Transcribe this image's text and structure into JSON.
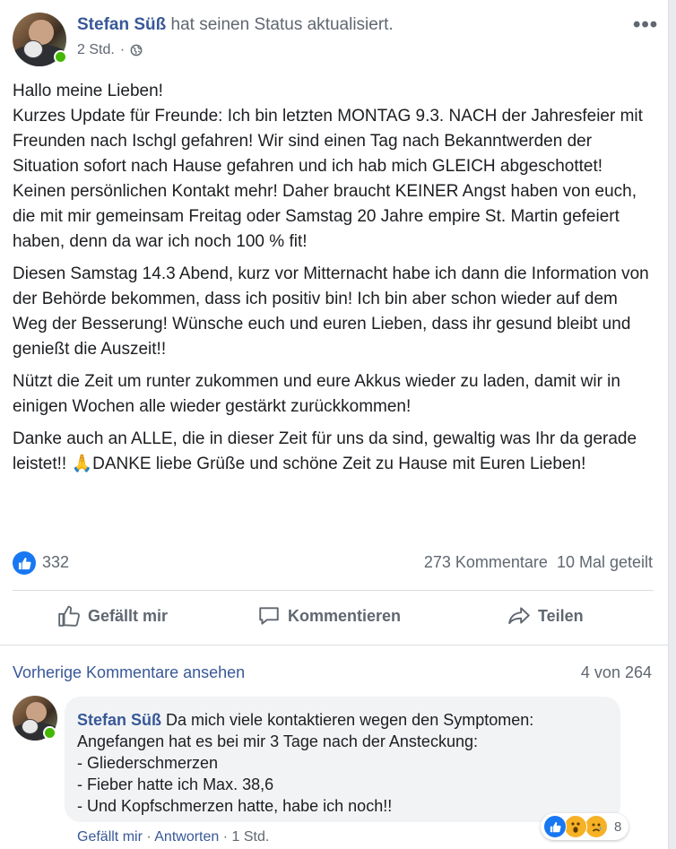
{
  "post": {
    "author": "Stefan Süß",
    "header_suffix": "hat seinen Status aktualisiert.",
    "time": "2 Std.",
    "more_label": "•••",
    "paragraphs": [
      "Hallo meine Lieben!\nKurzes Update für Freunde: Ich bin letzten MONTAG 9.3. NACH der Jahresfeier mit Freunden nach Ischgl gefahren! Wir sind einen Tag nach Bekanntwerden der Situation sofort nach Hause gefahren und ich hab mich GLEICH abgeschottet! Keinen persönlichen Kontakt mehr! Daher braucht KEINER Angst haben von euch, die mit mir gemeinsam Freitag oder Samstag 20 Jahre empire St. Martin gefeiert haben, denn da war ich noch 100 % fit!",
      "Diesen Samstag 14.3 Abend, kurz vor Mitternacht habe ich dann die Information von der Behörde bekommen, dass ich positiv bin! Ich bin aber schon wieder auf dem Weg der Besserung! Wünsche euch und euren Lieben, dass ihr gesund bleibt und genießt die Auszeit!!",
      "Nützt die Zeit um runter zukommen und eure Akkus wieder zu laden, damit wir in einigen Wochen alle wieder gestärkt zurückkommen!",
      "Danke auch an ALLE, die in dieser Zeit für uns da sind, gewaltig was Ihr da gerade leistet!! 🙏DANKE liebe Grüße und schöne Zeit zu Hause mit Euren Lieben!"
    ],
    "likes": "332",
    "comments_count": "273 Kommentare",
    "shares_count": "10 Mal geteilt"
  },
  "actions": {
    "like": "Gefällt mir",
    "comment": "Kommentieren",
    "share": "Teilen"
  },
  "comments_section": {
    "previous_link": "Vorherige Kommentare ansehen",
    "position": "4 von 264"
  },
  "comment": {
    "author": "Stefan Süß",
    "lines": [
      "Da mich viele kontaktieren wegen den Symptomen:",
      "Angefangen hat es bei mir 3 Tage nach der Ansteckung:",
      "- Gliederschmerzen",
      "- Fieber hatte ich Max. 38,6",
      "- Und Kopfschmerzen hatte, habe ich noch!!"
    ],
    "reaction_count": "8",
    "like_action": "Gefällt mir",
    "reply_action": "Antworten",
    "time": "1 Std.",
    "separator": "·"
  },
  "colors": {
    "link_blue": "#385898",
    "like_blue": "#1877f2",
    "online_green": "#44b700",
    "secondary_text": "#606770"
  }
}
